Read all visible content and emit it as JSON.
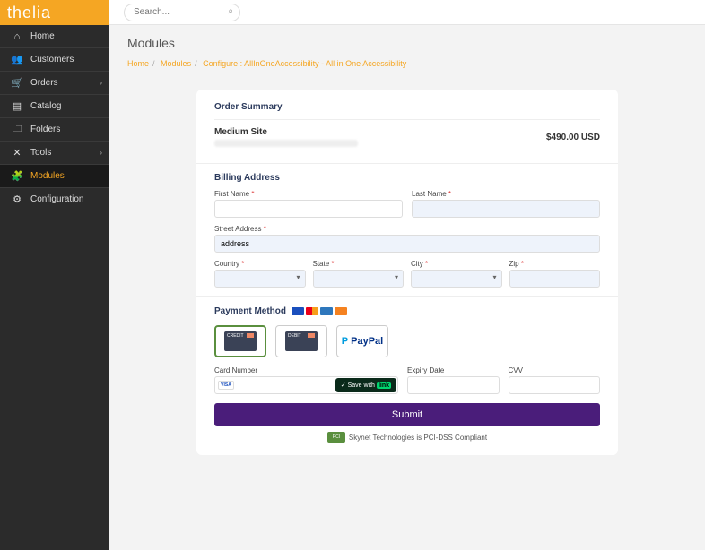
{
  "logo": "thelia",
  "search": {
    "placeholder": "Search..."
  },
  "sidebar": {
    "items": [
      {
        "icon": "⌂",
        "label": "Home"
      },
      {
        "icon": "👥",
        "label": "Customers"
      },
      {
        "icon": "🛒",
        "label": "Orders",
        "expand": true
      },
      {
        "icon": "▤",
        "label": "Catalog"
      },
      {
        "icon": "🗀",
        "label": "Folders"
      },
      {
        "icon": "✕",
        "label": "Tools",
        "expand": true
      },
      {
        "icon": "🧩",
        "label": "Modules",
        "active": true
      },
      {
        "icon": "⚙",
        "label": "Configuration"
      }
    ]
  },
  "page": {
    "title": "Modules"
  },
  "breadcrumb": {
    "p0": "Home",
    "p1": "Modules",
    "p2": "Configure : AllInOneAccessibility - All in One Accessibility"
  },
  "order": {
    "section": "Order Summary",
    "name": "Medium Site",
    "price": "$490.00 USD"
  },
  "billing": {
    "section": "Billing Address",
    "first": "First Name",
    "last": "Last Name",
    "street": "Street Address",
    "street_val": "address",
    "country": "Country",
    "state": "State",
    "city": "City",
    "zip": "Zip"
  },
  "payment": {
    "section": "Payment Method",
    "credit": "CREDIT",
    "debit": "DEBIT",
    "paypal": "PayPal",
    "card": "Card Number",
    "expiry": "Expiry Date",
    "cvv": "CVV",
    "save": "Save with",
    "link": "link",
    "submit": "Submit",
    "pci": "Skynet Technologies is PCI-DSS Compliant",
    "visa_badge": "VISA"
  }
}
